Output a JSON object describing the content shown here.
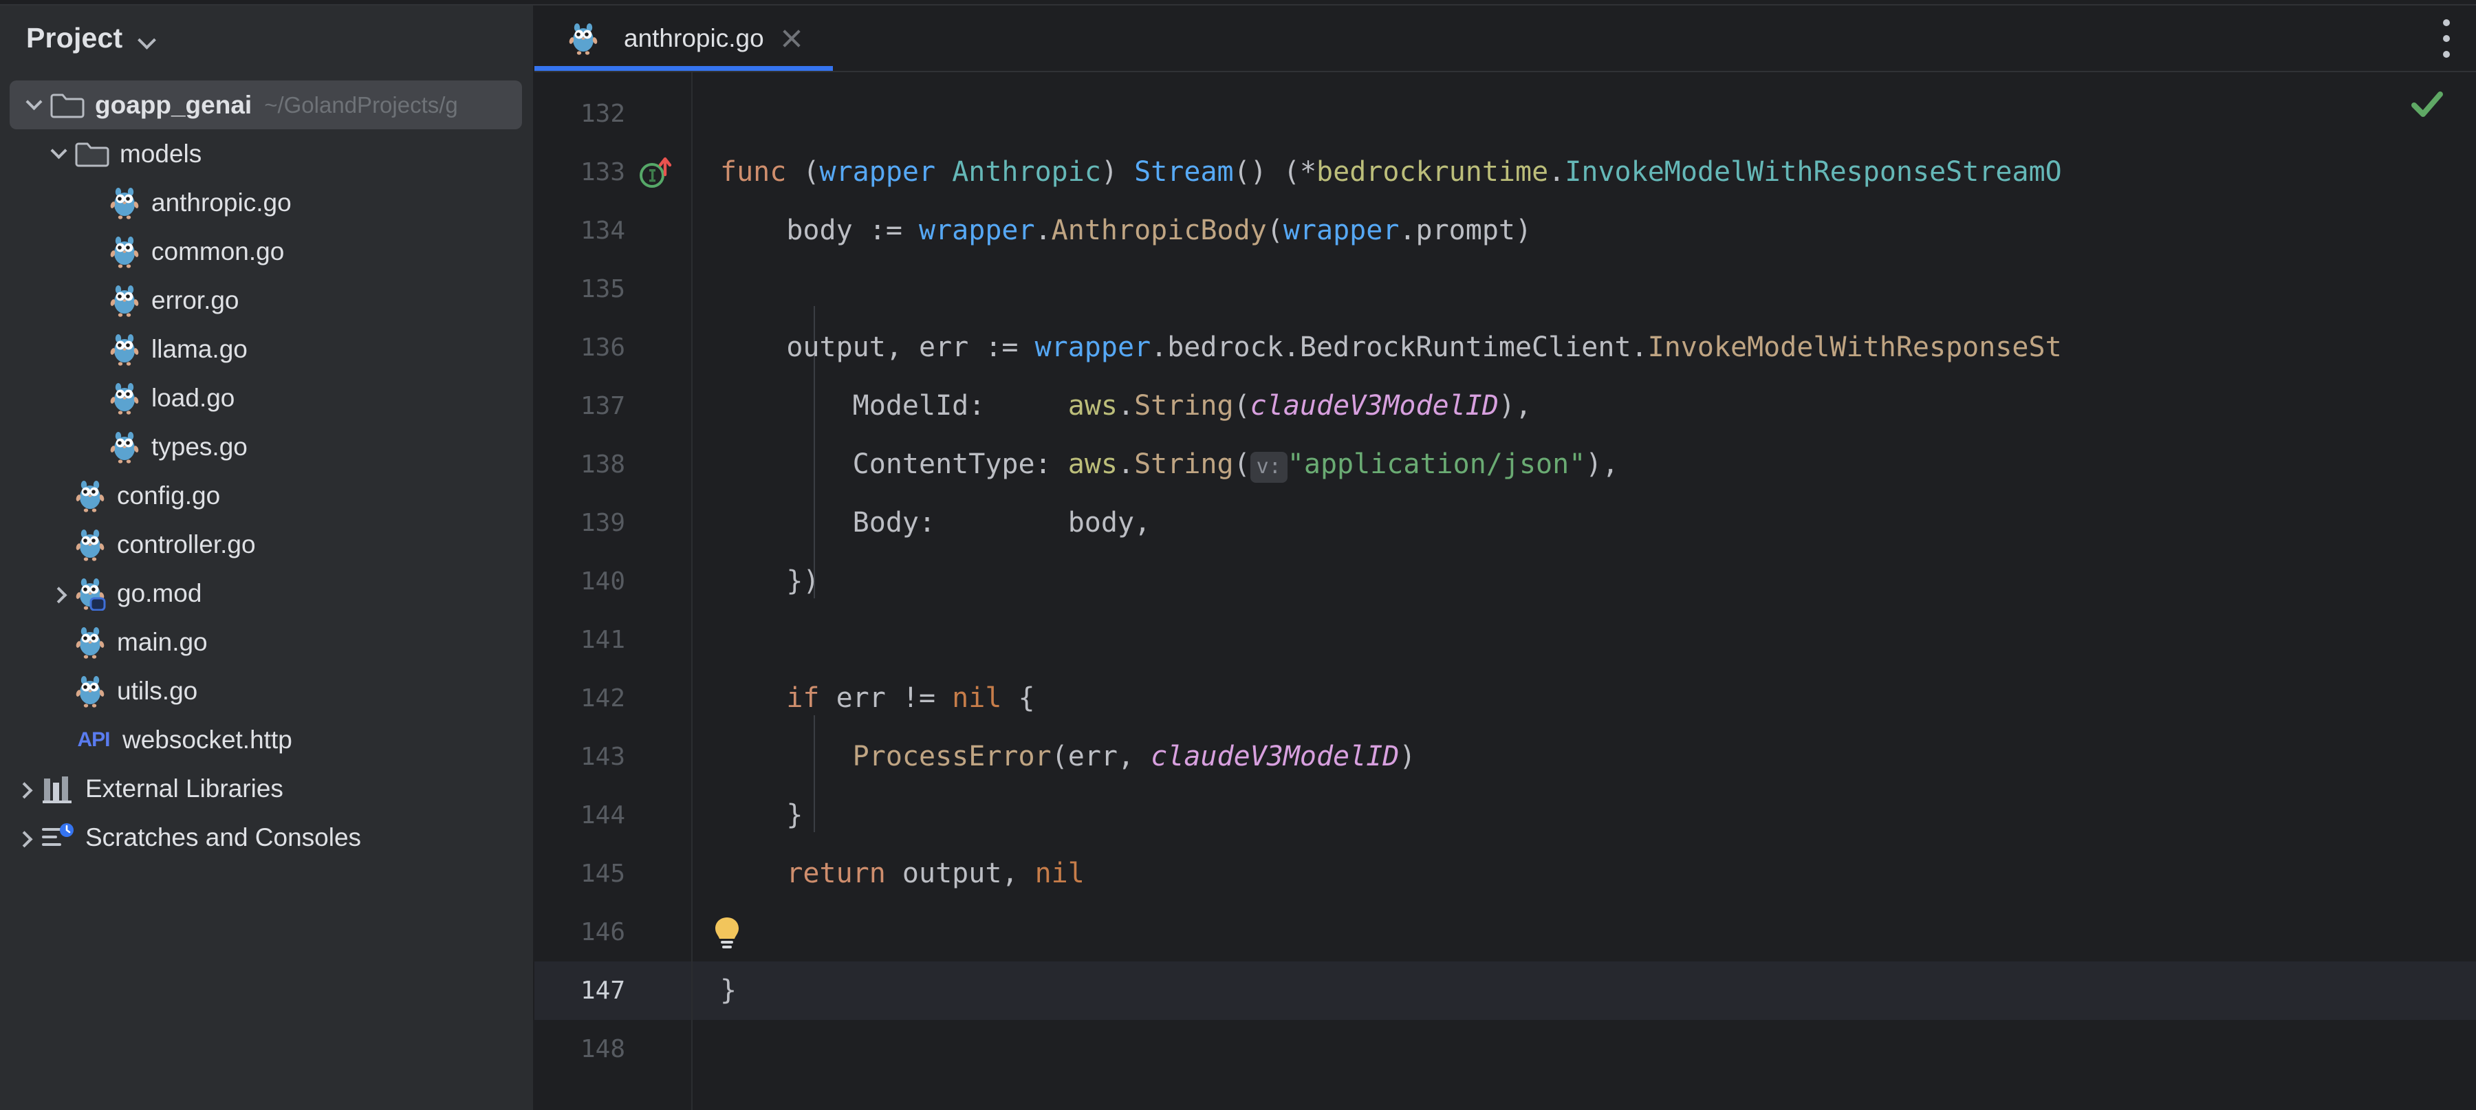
{
  "window": {
    "background": "#1e1f22",
    "sidebar_background": "#2b2d30",
    "accent": "#3574f0"
  },
  "sidebar": {
    "title": "Project",
    "title_chevron_icon": "chevron-down-icon",
    "items": [
      {
        "label": "goapp_genai",
        "path": "~/GolandProjects/g",
        "icon": "folder-icon",
        "twisty": "down",
        "depth": 0,
        "selected": true,
        "bold": true
      },
      {
        "label": "models",
        "path": "",
        "icon": "folder-icon",
        "twisty": "down",
        "depth": 1,
        "selected": false,
        "bold": false
      },
      {
        "label": "anthropic.go",
        "path": "",
        "icon": "go-file-icon",
        "twisty": "none",
        "depth": 2,
        "selected": false,
        "bold": false
      },
      {
        "label": "common.go",
        "path": "",
        "icon": "go-file-icon",
        "twisty": "none",
        "depth": 2,
        "selected": false,
        "bold": false
      },
      {
        "label": "error.go",
        "path": "",
        "icon": "go-file-icon",
        "twisty": "none",
        "depth": 2,
        "selected": false,
        "bold": false
      },
      {
        "label": "llama.go",
        "path": "",
        "icon": "go-file-icon",
        "twisty": "none",
        "depth": 2,
        "selected": false,
        "bold": false
      },
      {
        "label": "load.go",
        "path": "",
        "icon": "go-file-icon",
        "twisty": "none",
        "depth": 2,
        "selected": false,
        "bold": false
      },
      {
        "label": "types.go",
        "path": "",
        "icon": "go-file-icon",
        "twisty": "none",
        "depth": 2,
        "selected": false,
        "bold": false
      },
      {
        "label": "config.go",
        "path": "",
        "icon": "go-file-icon",
        "twisty": "none",
        "depth": 1,
        "selected": false,
        "bold": false
      },
      {
        "label": "controller.go",
        "path": "",
        "icon": "go-file-icon",
        "twisty": "none",
        "depth": 1,
        "selected": false,
        "bold": false
      },
      {
        "label": "go.mod",
        "path": "",
        "icon": "go-mod-icon",
        "twisty": "right",
        "depth": 1,
        "selected": false,
        "bold": false
      },
      {
        "label": "main.go",
        "path": "",
        "icon": "go-file-icon",
        "twisty": "none",
        "depth": 1,
        "selected": false,
        "bold": false
      },
      {
        "label": "utils.go",
        "path": "",
        "icon": "go-file-icon",
        "twisty": "none",
        "depth": 1,
        "selected": false,
        "bold": false
      },
      {
        "label": "websocket.http",
        "path": "",
        "icon": "api-http-icon",
        "twisty": "none",
        "depth": 1,
        "selected": false,
        "bold": false
      },
      {
        "label": "External Libraries",
        "path": "",
        "icon": "libraries-icon",
        "twisty": "right",
        "depth": 0,
        "selected": false,
        "bold": false
      },
      {
        "label": "Scratches and Consoles",
        "path": "",
        "icon": "scratches-icon",
        "twisty": "right",
        "depth": 0,
        "selected": false,
        "bold": false
      }
    ]
  },
  "editor": {
    "tab": {
      "label": "anthropic.go",
      "icon": "go-file-icon",
      "close_icon": "close-icon",
      "active": true
    },
    "more_options_icon": "kebab-menu-icon",
    "inspection_status_icon": "check-icon",
    "inspection_status_color": "#5FA865",
    "current_line": 147,
    "first_line": 132,
    "gutter": {
      "line_133_marker_icon": "implemented-method-icon",
      "line_146_marker_icon": "intention-bulb-icon"
    },
    "lines": [
      {
        "n": 132,
        "tokens": []
      },
      {
        "n": 133,
        "tokens": [
          {
            "t": "func",
            "c": "k-func"
          },
          {
            "t": " ",
            "c": "t-plain"
          },
          {
            "t": "(",
            "c": "t-paren"
          },
          {
            "t": "wrapper",
            "c": "t-param"
          },
          {
            "t": " ",
            "c": "t-plain"
          },
          {
            "t": "Anthropic",
            "c": "t-type"
          },
          {
            "t": ") ",
            "c": "t-paren"
          },
          {
            "t": "Stream",
            "c": "t-method"
          },
          {
            "t": "() (*",
            "c": "t-paren"
          },
          {
            "t": "bedrockruntime",
            "c": "t-pkgtype"
          },
          {
            "t": ".",
            "c": "t-plain"
          },
          {
            "t": "InvokeModelWithResponseStreamO",
            "c": "t-type"
          }
        ]
      },
      {
        "n": 134,
        "tokens": [
          {
            "t": "    body ",
            "c": "t-plain"
          },
          {
            "t": ":= ",
            "c": "t-plain"
          },
          {
            "t": "wrapper",
            "c": "t-param"
          },
          {
            "t": ".",
            "c": "t-plain"
          },
          {
            "t": "AnthropicBody",
            "c": "t-call"
          },
          {
            "t": "(",
            "c": "t-paren"
          },
          {
            "t": "wrapper",
            "c": "t-param"
          },
          {
            "t": ".prompt)",
            "c": "t-plain"
          }
        ]
      },
      {
        "n": 135,
        "tokens": []
      },
      {
        "n": 136,
        "tokens": [
          {
            "t": "    output, err ",
            "c": "t-plain"
          },
          {
            "t": ":= ",
            "c": "t-plain"
          },
          {
            "t": "wrapper",
            "c": "t-param"
          },
          {
            "t": ".bedrock.BedrockRuntimeClient.",
            "c": "t-plain"
          },
          {
            "t": "InvokeModelWithResponseSt",
            "c": "t-call"
          }
        ]
      },
      {
        "n": 137,
        "tokens": [
          {
            "t": "        ModelId:     ",
            "c": "t-plain"
          },
          {
            "t": "aws",
            "c": "t-pkgtype"
          },
          {
            "t": ".",
            "c": "t-plain"
          },
          {
            "t": "String",
            "c": "t-call"
          },
          {
            "t": "(",
            "c": "t-paren"
          },
          {
            "t": "claudeV3ModelID",
            "c": "t-const"
          },
          {
            "t": "),",
            "c": "t-paren"
          }
        ]
      },
      {
        "n": 138,
        "tokens": [
          {
            "t": "        ContentType: ",
            "c": "t-plain"
          },
          {
            "t": "aws",
            "c": "t-pkgtype"
          },
          {
            "t": ".",
            "c": "t-plain"
          },
          {
            "t": "String",
            "c": "t-call"
          },
          {
            "t": "(",
            "c": "t-paren"
          },
          {
            "t": "v:",
            "c": "inlay"
          },
          {
            "t": "\"application/json\"",
            "c": "t-str"
          },
          {
            "t": "),",
            "c": "t-paren"
          }
        ]
      },
      {
        "n": 139,
        "tokens": [
          {
            "t": "        Body:        body,",
            "c": "t-plain"
          }
        ]
      },
      {
        "n": 140,
        "tokens": [
          {
            "t": "    })",
            "c": "t-paren"
          }
        ]
      },
      {
        "n": 141,
        "tokens": []
      },
      {
        "n": 142,
        "tokens": [
          {
            "t": "    ",
            "c": "t-plain"
          },
          {
            "t": "if",
            "c": "k-kw"
          },
          {
            "t": " err != ",
            "c": "t-plain"
          },
          {
            "t": "nil",
            "c": "k-nil"
          },
          {
            "t": " {",
            "c": "t-paren"
          }
        ]
      },
      {
        "n": 143,
        "tokens": [
          {
            "t": "        ",
            "c": "t-plain"
          },
          {
            "t": "ProcessError",
            "c": "t-call"
          },
          {
            "t": "(",
            "c": "t-paren"
          },
          {
            "t": "err, ",
            "c": "t-plain"
          },
          {
            "t": "claudeV3ModelID",
            "c": "t-const"
          },
          {
            "t": ")",
            "c": "t-paren"
          }
        ]
      },
      {
        "n": 144,
        "tokens": [
          {
            "t": "    }",
            "c": "t-paren"
          }
        ]
      },
      {
        "n": 145,
        "tokens": [
          {
            "t": "    ",
            "c": "t-plain"
          },
          {
            "t": "return",
            "c": "k-func"
          },
          {
            "t": " output, ",
            "c": "t-plain"
          },
          {
            "t": "nil",
            "c": "k-nil"
          }
        ]
      },
      {
        "n": 146,
        "tokens": []
      },
      {
        "n": 147,
        "tokens": [
          {
            "t": "}",
            "c": "t-paren"
          }
        ]
      },
      {
        "n": 148,
        "tokens": []
      }
    ]
  }
}
